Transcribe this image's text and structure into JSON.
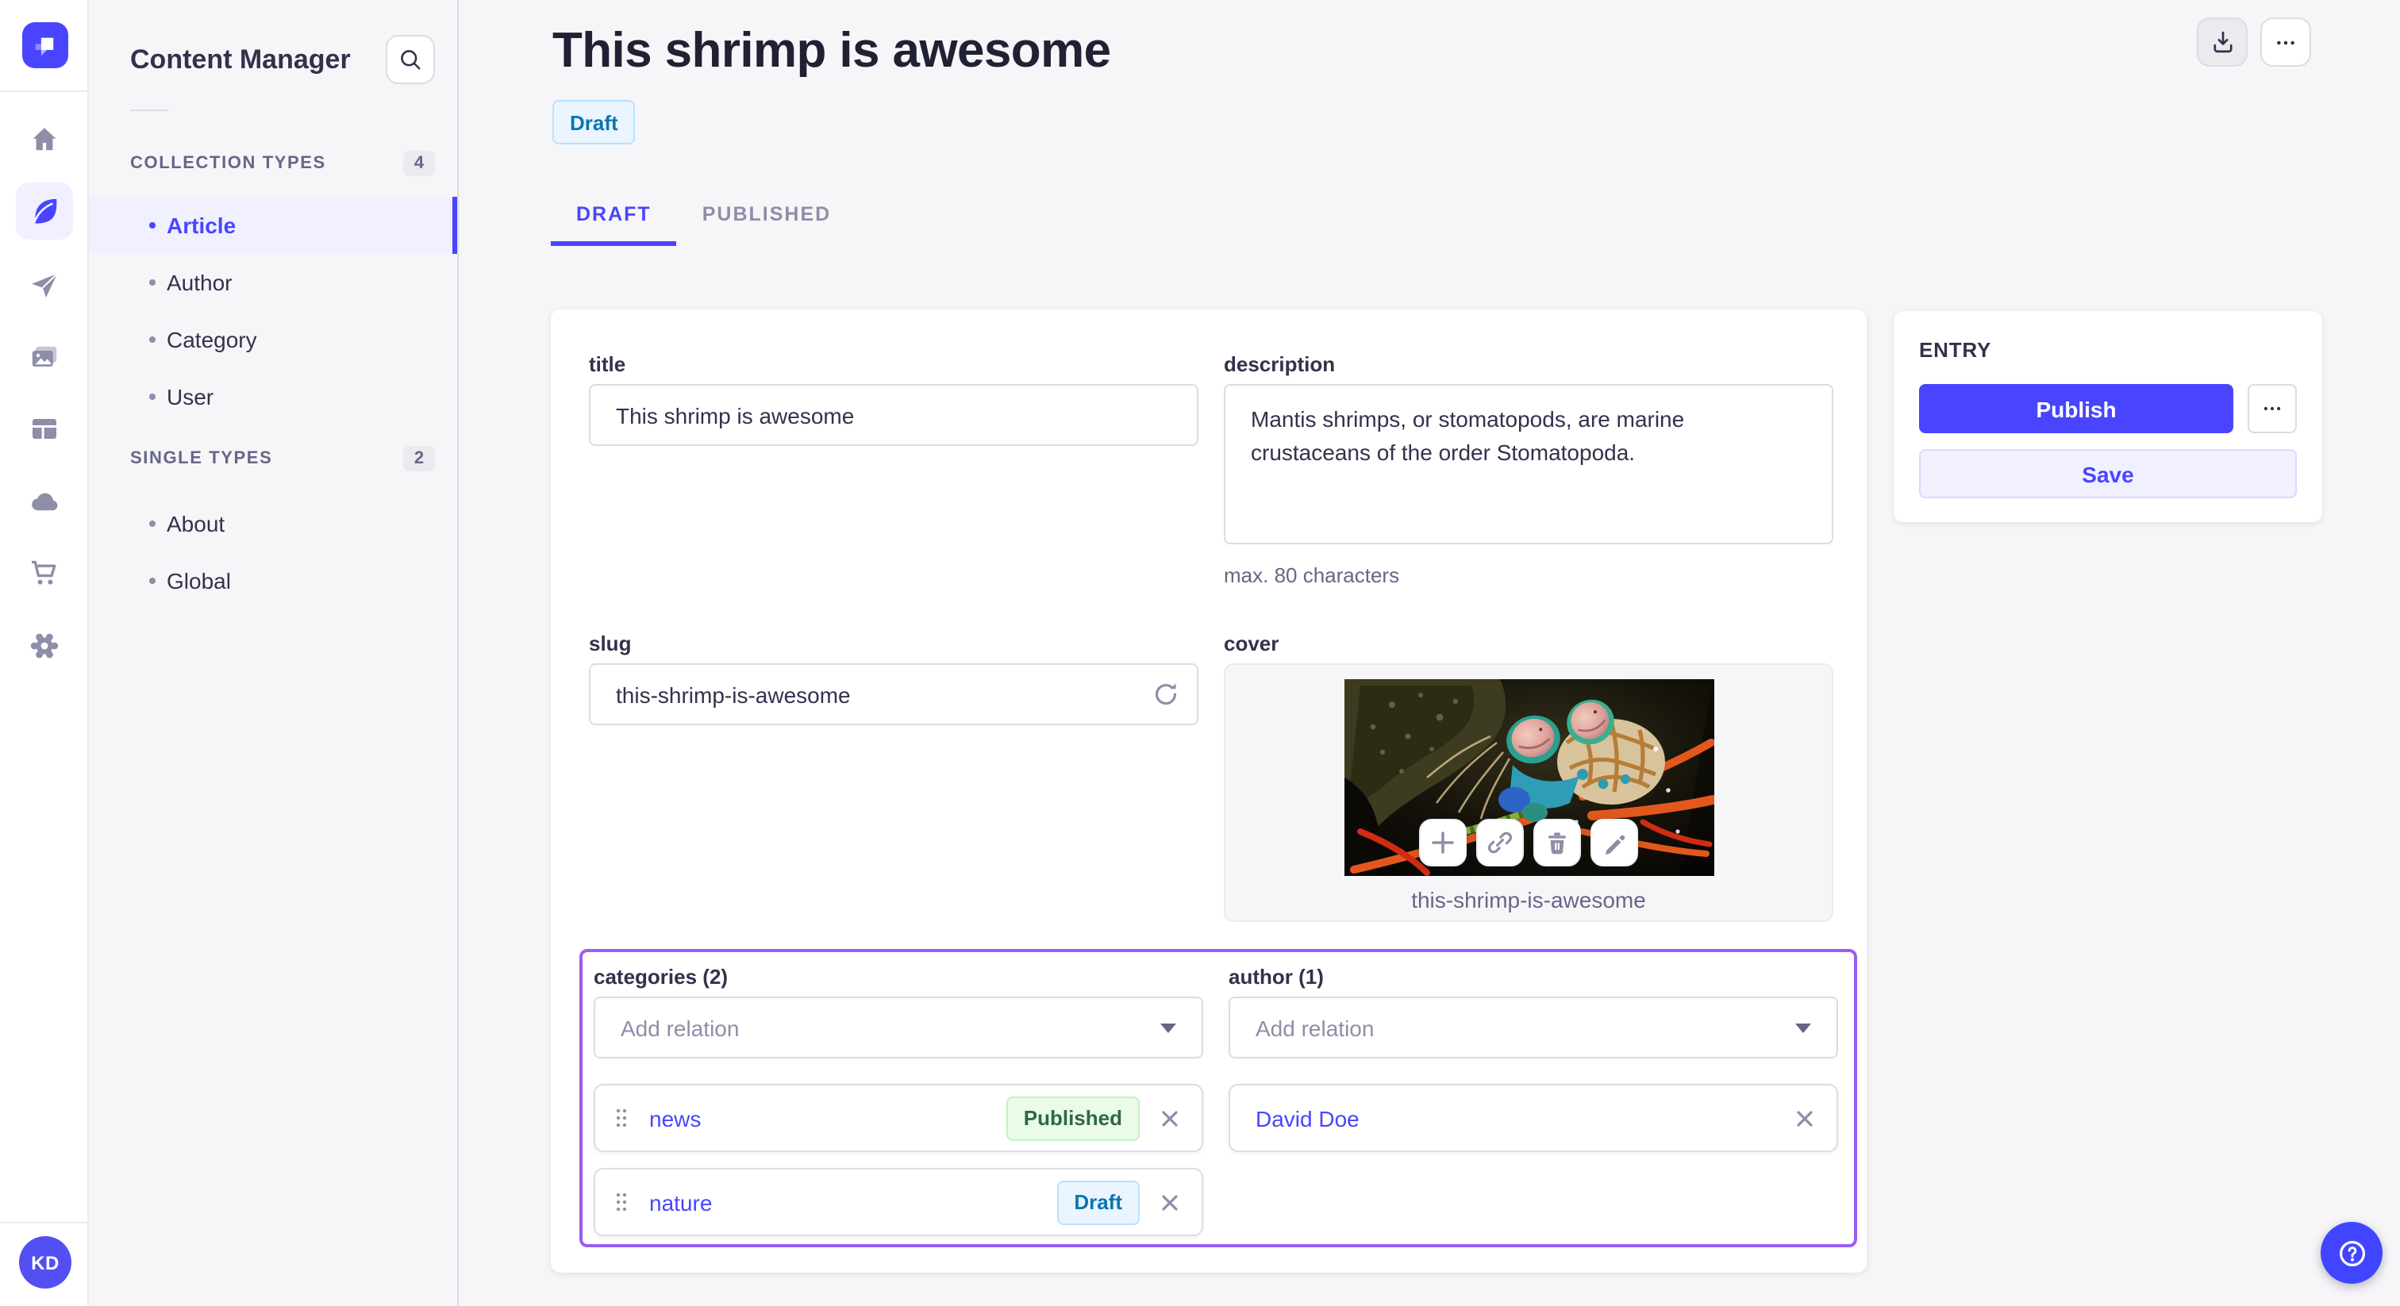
{
  "rail": {
    "avatar_initials": "KD",
    "icons": [
      "home",
      "content-manager",
      "releases",
      "media-library",
      "content-type-builder",
      "deploy",
      "marketplace",
      "settings"
    ]
  },
  "sidebar": {
    "title": "Content Manager",
    "sections": [
      {
        "label": "COLLECTION TYPES",
        "count": "4",
        "items": [
          {
            "label": "Article"
          },
          {
            "label": "Author"
          },
          {
            "label": "Category"
          },
          {
            "label": "User"
          }
        ]
      },
      {
        "label": "SINGLE TYPES",
        "count": "2",
        "items": [
          {
            "label": "About"
          },
          {
            "label": "Global"
          }
        ]
      }
    ]
  },
  "header": {
    "title": "This shrimp is awesome",
    "status": "Draft"
  },
  "tabs": [
    {
      "label": "DRAFT"
    },
    {
      "label": "PUBLISHED"
    }
  ],
  "form": {
    "title": {
      "label": "title",
      "value": "This shrimp is awesome"
    },
    "description": {
      "label": "description",
      "value": "Mantis shrimps, or stomatopods, are marine crustaceans of the order Stomatopoda.",
      "hint": "max. 80 characters"
    },
    "slug": {
      "label": "slug",
      "value": "this-shrimp-is-awesome"
    },
    "cover": {
      "label": "cover",
      "filename": "this-shrimp-is-awesome"
    }
  },
  "relations": {
    "categories": {
      "label": "categories (2)",
      "placeholder": "Add relation",
      "items": [
        {
          "name": "news",
          "status": "Published"
        },
        {
          "name": "nature",
          "status": "Draft"
        }
      ]
    },
    "author": {
      "label": "author (1)",
      "placeholder": "Add relation",
      "items": [
        {
          "name": "David Doe"
        }
      ]
    }
  },
  "entry": {
    "heading": "ENTRY",
    "publish_label": "Publish",
    "save_label": "Save"
  },
  "colors": {
    "accent": "#4945ff",
    "draft_bg": "#eaf5ff",
    "draft_border": "#b8e1ff",
    "draft_text": "#0c75af",
    "published_bg": "#eafbe7",
    "published_border": "#c6f0c2",
    "published_text": "#2f6846",
    "section_highlight": "#9a5cf5"
  }
}
